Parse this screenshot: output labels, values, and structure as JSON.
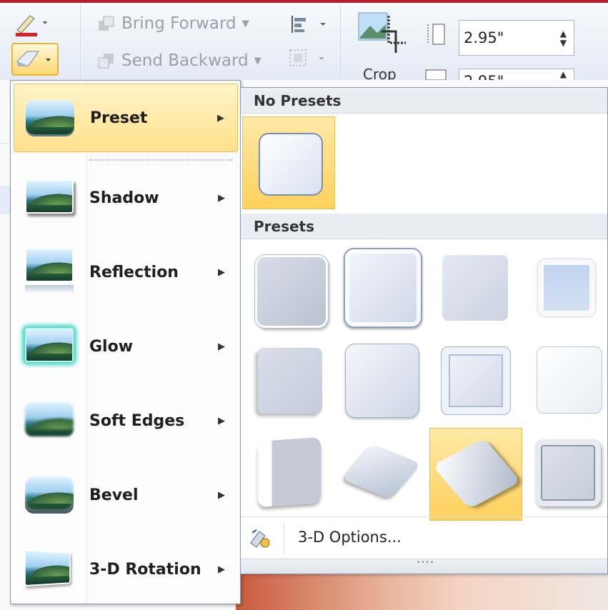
{
  "ribbon": {
    "bring_forward": "Bring Forward",
    "send_backward": "Send Backward",
    "crop": "Crop",
    "height_value": "2.95\"",
    "width_value": "2.95\""
  },
  "menu": {
    "items": [
      {
        "label": "Preset",
        "selected": true
      },
      {
        "label": "Shadow"
      },
      {
        "label": "Reflection"
      },
      {
        "label": "Glow"
      },
      {
        "label": "Soft Edges"
      },
      {
        "label": "Bevel"
      },
      {
        "label": "3-D Rotation"
      }
    ]
  },
  "gallery": {
    "no_presets_header": "No Presets",
    "presets_header": "Presets",
    "options_label": "3-D Options..."
  },
  "colors": {
    "selected_fill": "#ffd86a",
    "selected_border": "#e3c25a",
    "menu_border": "#8b99ad"
  }
}
